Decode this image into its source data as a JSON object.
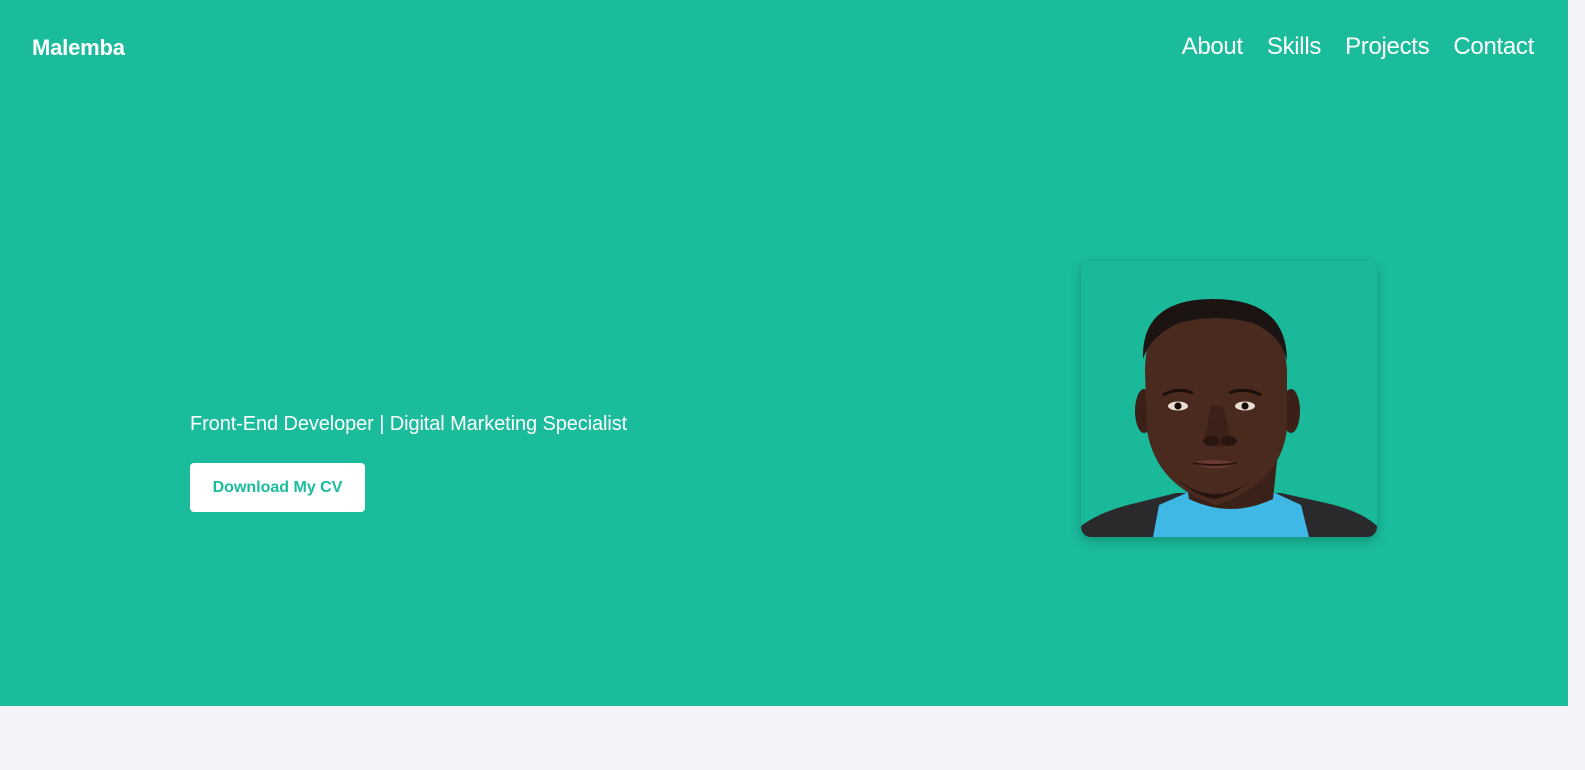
{
  "header": {
    "brand": "Malemba",
    "nav": [
      {
        "label": "About"
      },
      {
        "label": "Skills"
      },
      {
        "label": "Projects"
      },
      {
        "label": "Contact"
      }
    ]
  },
  "hero": {
    "tagline": "Front-End Developer | Digital Marketing Specialist",
    "cta_label": "Download My CV",
    "portrait": "profile-photo"
  },
  "colors": {
    "accent": "#1abc9c",
    "page_background": "#f3f3f8",
    "text_on_accent": "#ffffff"
  }
}
